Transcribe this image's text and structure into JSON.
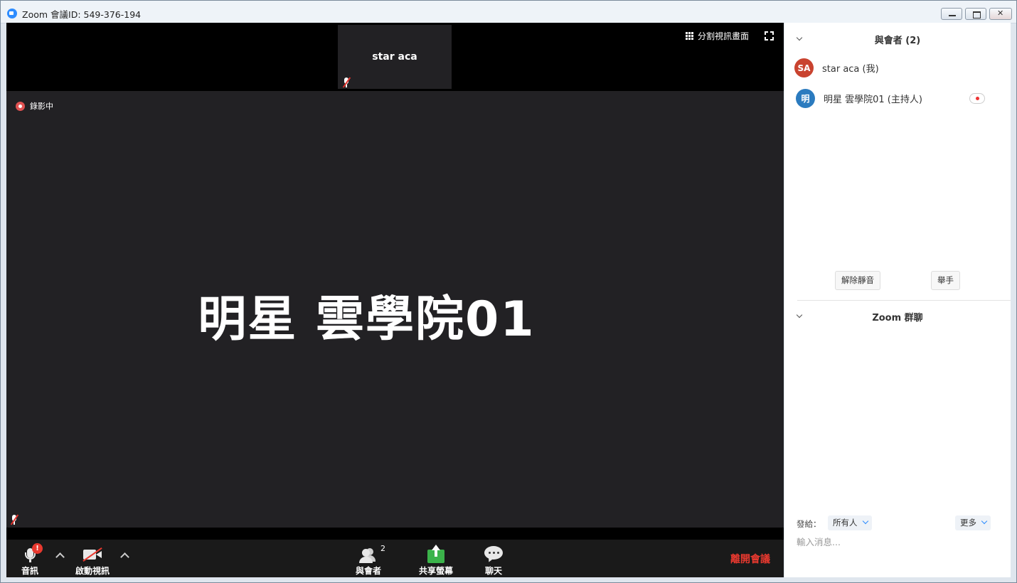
{
  "window": {
    "title": "Zoom 會議ID: 549-376-194"
  },
  "video": {
    "thumbnail_name": "star aca",
    "gallery_view_label": "分割視訊畫面",
    "recording_label": "錄影中",
    "active_speaker_name": "明星 雲學院01"
  },
  "toolbar": {
    "audio_label": "音訊",
    "video_label": "啟動視訊",
    "participants_label": "與會者",
    "participants_count": "2",
    "share_label": "共享螢幕",
    "chat_label": "聊天",
    "leave_label": "離開會議",
    "alert_badge": "!"
  },
  "participants_panel": {
    "title": "與會者 (2)",
    "items": [
      {
        "initials": "SA",
        "name": "star aca (我)",
        "color": "#c9432f"
      },
      {
        "initials": "明",
        "name": "明星 雲學院01 (主持人)",
        "color": "#2b7bbf"
      }
    ],
    "unmute_button": "解除靜音",
    "raise_hand_button": "舉手"
  },
  "chat_panel": {
    "title": "Zoom 群聊",
    "send_to_label": "發給：",
    "recipient": "所有人",
    "more_label": "更多",
    "input_placeholder": "輸入消息..."
  },
  "colors": {
    "accent": "#2d8cff",
    "leave": "#e8392f",
    "share": "#3bb34a",
    "recording": "#e05252"
  }
}
